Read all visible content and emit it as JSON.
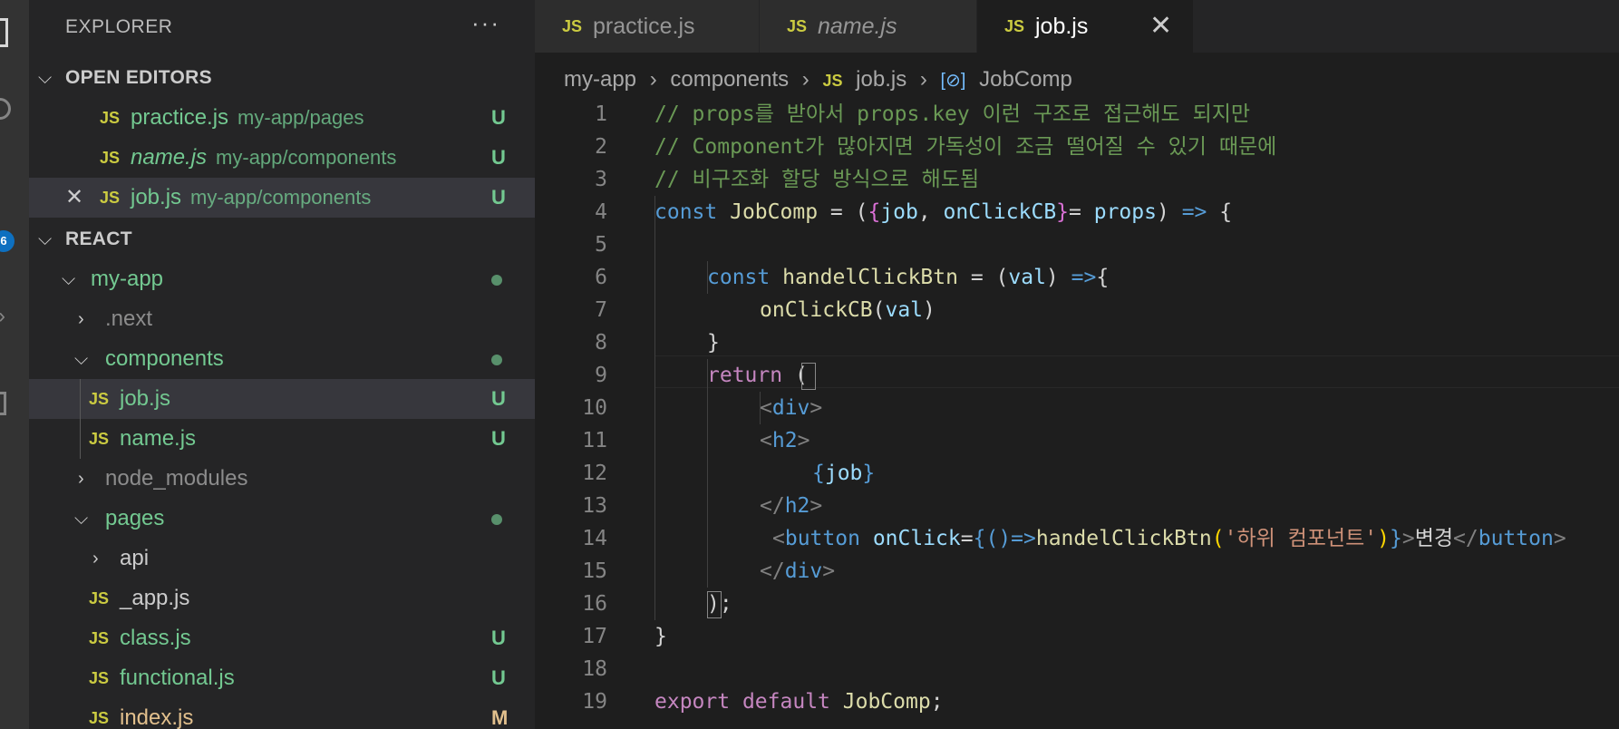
{
  "explorer": {
    "title": "EXPLORER",
    "more": "···",
    "open_editors": {
      "label": "OPEN EDITORS",
      "items": [
        {
          "icon": "JS",
          "name": "practice.js",
          "path": "my-app/pages",
          "status": "U"
        },
        {
          "icon": "JS",
          "name": "name.js",
          "path": "my-app/components",
          "status": "U"
        },
        {
          "icon": "JS",
          "name": "job.js",
          "path": "my-app/components",
          "status": "U",
          "close": "✕"
        }
      ]
    },
    "workspace": {
      "label": "REACT",
      "items": [
        {
          "name": "my-app"
        },
        {
          "name": ".next"
        },
        {
          "name": "components"
        },
        {
          "icon": "JS",
          "name": "job.js",
          "status": "U"
        },
        {
          "icon": "JS",
          "name": "name.js",
          "status": "U"
        },
        {
          "name": "node_modules"
        },
        {
          "name": "pages"
        },
        {
          "name": "api"
        },
        {
          "icon": "JS",
          "name": "_app.js"
        },
        {
          "icon": "JS",
          "name": "class.js",
          "status": "U"
        },
        {
          "icon": "JS",
          "name": "functional.js",
          "status": "U"
        },
        {
          "icon": "JS",
          "name": "index.js",
          "status": "M"
        }
      ]
    }
  },
  "activity": {
    "badge": "6"
  },
  "tabs": [
    {
      "icon": "JS",
      "label": "practice.js"
    },
    {
      "icon": "JS",
      "label": "name.js"
    },
    {
      "icon": "JS",
      "label": "job.js",
      "close": "✕"
    }
  ],
  "breadcrumb": {
    "parts": [
      "my-app",
      "components"
    ],
    "file_icon": "JS",
    "file": "job.js",
    "symbol_icon": "[⊘]",
    "symbol": "JobComp",
    "sep": "›"
  },
  "code": {
    "line_numbers": [
      "1",
      "2",
      "3",
      "4",
      "5",
      "6",
      "7",
      "8",
      "9",
      "10",
      "11",
      "12",
      "13",
      "14",
      "15",
      "16",
      "17",
      "18",
      "19"
    ],
    "l1": "// props를 받아서 props.key 이런 구조로 접근해도 되지만",
    "l2": "// Component가 많아지면 가독성이 조금 떨어질 수 있기 때문에",
    "l3": "// 비구조화 할당 방식으로 해도됨",
    "const": "const",
    "JobComp": "JobComp",
    "eq": " = (",
    "lb": "{",
    "job": "job",
    "comma": ", ",
    "onClickCB": "onClickCB",
    "rb": "}",
    "eq2": "= ",
    "props": "props",
    "rp": ") ",
    "arrow": "=>",
    "ob": " {",
    "handel": "handelClickBtn",
    "eq3": " = (",
    "val": "val",
    "rp2": ") ",
    "arrow2": "=>",
    "ob2": "{",
    "call_on": "onClickCB",
    "lp": "(",
    "rp3": ")",
    "cb": "}",
    "return": "return",
    "rp_open": " (",
    "lt": "<",
    "gt": ">",
    "lts": "</",
    "div": "div",
    "h2": "h2",
    "button": "button",
    "onClick": "onClick",
    "eq4": "=",
    "arrowfn": "()=>",
    "handel2": "handelClickBtn",
    "str": "'하위 컴포넌트'",
    "btn_text": "변경",
    "close_paren": ");",
    "close_brace": "}",
    "export": "export",
    "default": "default",
    "export_name": "JobComp",
    "semi": ";"
  }
}
